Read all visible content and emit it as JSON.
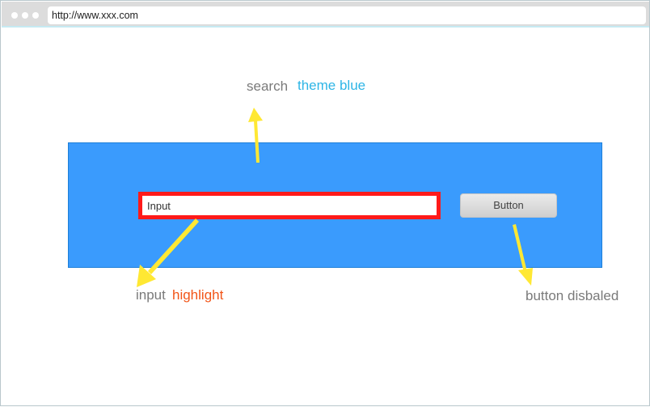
{
  "browser": {
    "url": "http://www.xxx.com"
  },
  "search_bar": {
    "input_value": "Input",
    "button_label": "Button"
  },
  "annotations": {
    "search_label": "search",
    "theme_label": "theme blue",
    "input_label": "input",
    "highlight_label": "highlight",
    "button_label": "button disbaled"
  },
  "colors": {
    "theme_blue": "#3a9bfd",
    "input_highlight_border": "#ff1a1a",
    "annotation_arrow": "#ffe833",
    "annotation_text_gray": "#7a7a7a",
    "annotation_text_blue": "#2eb5e6",
    "annotation_text_orange": "#f25518"
  },
  "icons": {
    "arrow": "annotation-arrow-icon",
    "window_dot": "window-dot-icon"
  }
}
